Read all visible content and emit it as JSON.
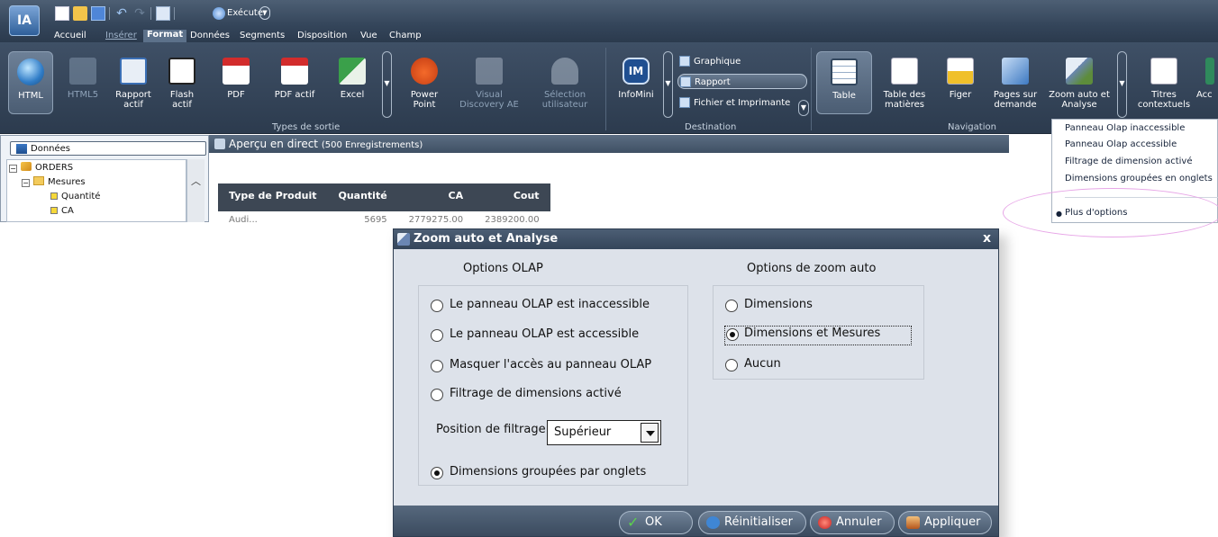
{
  "app": {
    "logo": "IA",
    "quick_access": {
      "run_label": "Exécuter"
    },
    "tabs": [
      "Accueil",
      "Insérer",
      "Format",
      "Données",
      "Segments",
      "Disposition",
      "Vue",
      "Champ"
    ],
    "active_tab": "Format"
  },
  "ribbon": {
    "output_buttons": [
      {
        "label": "HTML",
        "icon": "globe-icon"
      },
      {
        "label": "HTML5",
        "icon": "html5-icon"
      },
      {
        "label": "Rapport actif",
        "icon": "active-report-icon"
      },
      {
        "label": "Flash actif",
        "icon": "flash-icon"
      },
      {
        "label": "PDF",
        "icon": "pdf-icon"
      },
      {
        "label": "PDF actif",
        "icon": "pdf-active-icon"
      },
      {
        "label": "Excel",
        "icon": "excel-icon"
      },
      {
        "label": "Power Point",
        "icon": "powerpoint-icon"
      },
      {
        "label": "Visual Discovery AE",
        "icon": "visual-discovery-icon"
      },
      {
        "label": "Sélection utilisateur",
        "icon": "user-selection-icon"
      }
    ],
    "group_output": "Types de sortie",
    "infomini": "InfoMini",
    "destination_items": [
      "Graphique",
      "Rapport",
      "Fichier et Imprimante"
    ],
    "group_destination": "Destination",
    "nav_buttons": [
      {
        "label": "Table",
        "icon": "table-icon"
      },
      {
        "label": "Table des matières",
        "icon": "toc-icon"
      },
      {
        "label": "Figer",
        "icon": "freeze-icon"
      },
      {
        "label": "Pages sur demande",
        "icon": "pages-icon"
      }
    ],
    "group_navigation": "Navigation",
    "zoom_button": "Zoom auto et Analyse",
    "titres_button": "Titres contextuels",
    "acc_button": "Acc"
  },
  "data_panel": {
    "tab_label": "Données",
    "tree": [
      {
        "label": "ORDERS"
      },
      {
        "label": "Mesures"
      },
      {
        "label": "Quantité"
      },
      {
        "label": "CA"
      }
    ]
  },
  "preview": {
    "title": "Aperçu en direct",
    "count": "(500 Enregistrements)",
    "columns": [
      "Type de Produit",
      "Quantité",
      "CA",
      "Cout"
    ],
    "partial_row": [
      "Audi...",
      "5695",
      "2779275.00",
      "2389200.00"
    ]
  },
  "zoom_menu": {
    "items": [
      "Panneau Olap inaccessible",
      "Panneau Olap accessible",
      "Filtrage de dimension activé",
      "Dimensions groupées en onglets"
    ],
    "more": "Plus d'options"
  },
  "dialog": {
    "title": "Zoom auto et Analyse",
    "olap_title": "Options OLAP",
    "olap_options": [
      "Le panneau OLAP est inaccessible",
      "Le panneau OLAP est accessible",
      "Masquer l'accès au panneau OLAP",
      "Filtrage de dimensions activé"
    ],
    "filter_label": "Position de filtrage",
    "filter_value": "Supérieur",
    "grouped_option": "Dimensions groupées par onglets",
    "grouped_selected": true,
    "zoom_title": "Options de zoom auto",
    "zoom_options": [
      "Dimensions",
      "Dimensions et Mesures",
      "Aucun"
    ],
    "zoom_selected": "Dimensions et Mesures",
    "buttons": {
      "ok": "OK",
      "reset": "Réinitialiser",
      "cancel": "Annuler",
      "apply": "Appliquer"
    }
  }
}
